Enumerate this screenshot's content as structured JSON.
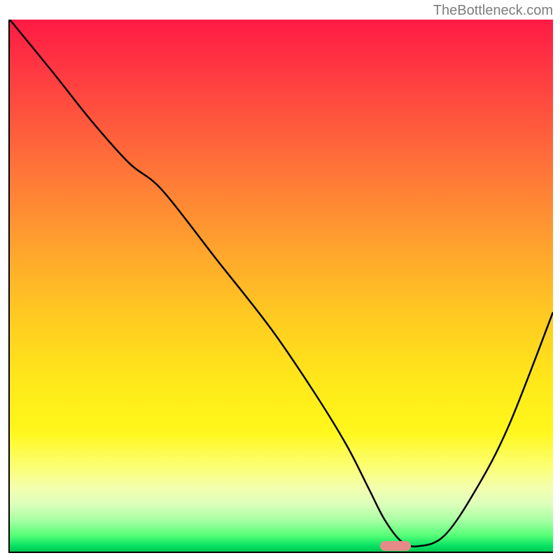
{
  "watermark": "TheBottleneck.com",
  "chart_data": {
    "type": "line",
    "title": "",
    "xlabel": "",
    "ylabel": "",
    "xlim": [
      0,
      100
    ],
    "ylim": [
      0,
      100
    ],
    "grid": false,
    "legend": false,
    "series": [
      {
        "name": "bottleneck-curve",
        "x": [
          0,
          8,
          15,
          22,
          28,
          38,
          48,
          56,
          62,
          66,
          69,
          72,
          75,
          80,
          86,
          92,
          100
        ],
        "values": [
          100,
          90,
          81,
          73,
          68,
          55,
          42,
          30,
          20,
          12,
          6,
          2,
          1,
          3,
          12,
          24,
          45
        ]
      }
    ],
    "marker": {
      "x": 71,
      "y": 1,
      "color": "#e68a88"
    },
    "background_gradient": {
      "top": "#ff1a44",
      "mid": "#ffe81a",
      "bottom": "#00c84f"
    }
  }
}
